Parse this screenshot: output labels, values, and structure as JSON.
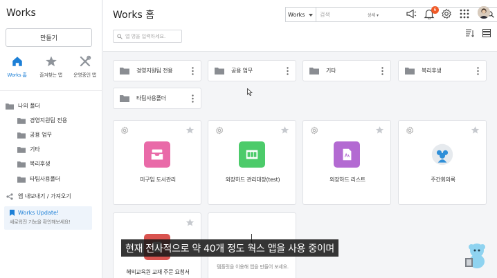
{
  "sidebar": {
    "app_title": "Works",
    "create_label": "만들기",
    "quick_nav": [
      {
        "label": "Works 홈",
        "icon": "home-icon"
      },
      {
        "label": "즐겨찾는 앱",
        "icon": "star-icon"
      },
      {
        "label": "운영중인 앱",
        "icon": "tools-icon"
      }
    ],
    "my_folder": "나의 폴더",
    "folders": [
      "경영지원팀 전용",
      "공용 업무",
      "기타",
      "복리후생",
      "타팀사용폴더"
    ],
    "share_label": "앱 내보내기 / 가져오기",
    "update_title": "Works Update!",
    "update_sub": "새로워진 기능을 확인해보세요!"
  },
  "header": {
    "title": "Works 홈",
    "search_scope": "Works",
    "search_placeholder": "검색",
    "detail_label": "상세",
    "notification_count": "6",
    "filter_placeholder": "앱 명을 입력하세요."
  },
  "folder_cards": [
    "경영지원팀 전용",
    "공용 업무",
    "기타",
    "복리후생",
    "타팀사용폴더"
  ],
  "app_cards": [
    {
      "name": "미구입 도서관리",
      "color": "#e96aa8",
      "icon": "inbox-icon"
    },
    {
      "name": "외장하드 관리대장(test)",
      "color": "#4ccb6a",
      "icon": "grid-icon"
    },
    {
      "name": "외장하드 리스트",
      "color": "#b36ad2",
      "icon": "document-icon"
    },
    {
      "name": "주간회의록",
      "color": "#2f8fd8",
      "icon": "people-icon"
    },
    {
      "name": "해외교육원 교재 주문 요청서",
      "color": "#d9534f",
      "icon": "order-icon"
    }
  ],
  "empty_card_text": "템플릿을 이용해 앱을 만들어 보세요.",
  "caption": "현재 전사적으로 약 40개 정도 웍스 앱을 사용 중이며",
  "colors": {
    "accent": "#1c7fd6",
    "badge": "#f05a28"
  }
}
